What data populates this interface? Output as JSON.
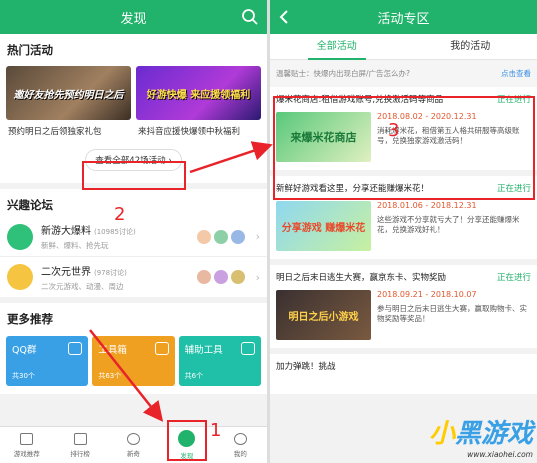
{
  "left": {
    "title": "发现",
    "hot_section": "热门活动",
    "cards": [
      {
        "caption": "预约明日之后领独家礼包",
        "art_text": "邀好友抢先预约明日之后"
      },
      {
        "caption": "来抖音应援快爆领中秋福利",
        "art_text": "好游快爆 来应援领福利"
      }
    ],
    "view_all": "查看全部42场活动 ›",
    "forum_section": "兴趣论坛",
    "forums": [
      {
        "name": "新游大爆料",
        "count": "(10985讨论)",
        "sub": "新鲜、爆料、抢先玩"
      },
      {
        "name": "二次元世界",
        "count": "(978讨论)",
        "sub": "二次元游戏、动漫、周边"
      }
    ],
    "more_section": "更多推荐",
    "tiles": [
      {
        "name": "QQ群",
        "count": "共30个",
        "color": "#3aa0e6"
      },
      {
        "name": "工具箱",
        "count": "共63个",
        "color": "#f0a020"
      },
      {
        "name": "辅助工具",
        "count": "共6个",
        "color": "#1fbfa8"
      }
    ],
    "tabbar": [
      {
        "label": "游戏推荐"
      },
      {
        "label": "排行榜"
      },
      {
        "label": "新奇"
      },
      {
        "label": "发现"
      },
      {
        "label": "我的"
      }
    ]
  },
  "right": {
    "title": "活动专区",
    "tabs": [
      "全部活动",
      "我的活动"
    ],
    "tip": "温馨贴士：快爆内出现白屏/广告怎么办?",
    "tip_link": "点击查看",
    "activities": [
      {
        "title": "爆米花商店:租借游戏账号,兑换激活码等商品",
        "status": "正在进行",
        "date": "2018.08.02 - 2020.12.31",
        "desc": "消耗爆米花，租借第五人格共研服等高级账号，兑换独家游戏激活码！",
        "art": "来爆米花商店"
      },
      {
        "title": "新鲜好游戏看这里，分享还能赚爆米花！",
        "status": "正在进行",
        "date": "2018.01.06 - 2018.12.31",
        "desc": "这些游戏不分享就亏大了！分享还能赚爆米花，兑换游戏好礼！",
        "art": "分享游戏 赚爆米花"
      },
      {
        "title": "明日之后末日逃生大赛，赢京东卡、实物奖励",
        "status": "正在进行",
        "date": "2018.09.21 - 2018.10.07",
        "desc": "参与明日之后末日逃生大赛，赢取购物卡、实物奖励等奖品！",
        "art": "明日之后小游戏"
      },
      {
        "title": "加力弹跳！挑战",
        "status": "",
        "date": "",
        "desc": "",
        "art": ""
      }
    ]
  },
  "annotations": {
    "n1": "1",
    "n2": "2",
    "n3": "3"
  },
  "watermark": {
    "brand_a": "小",
    "brand_b": "黑游戏",
    "url": "www.xiaohei.com"
  },
  "colors": {
    "brand": "#21b26b",
    "annotation": "#e8232a",
    "date": "#e0562c"
  }
}
